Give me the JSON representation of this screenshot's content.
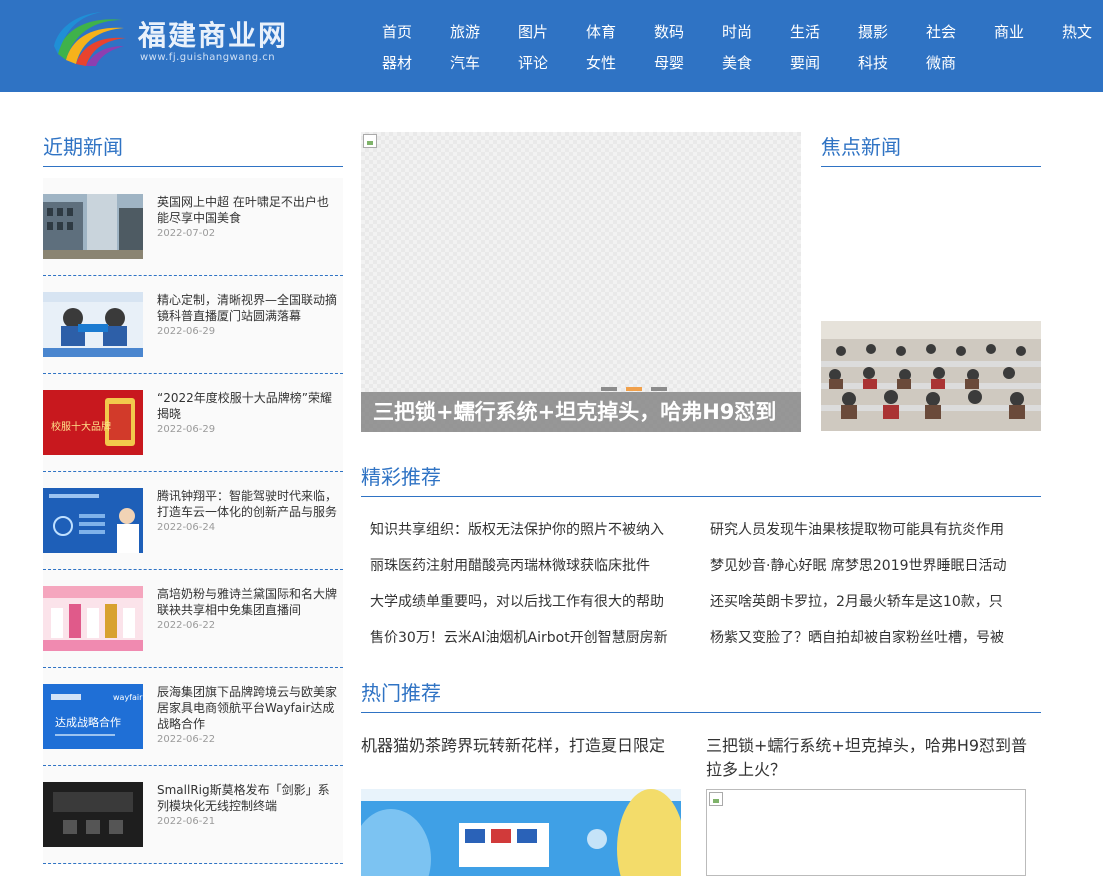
{
  "header": {
    "logo_title": "福建商业网",
    "logo_url": "www.fj.guishangwang.cn",
    "nav_row1": [
      "首页",
      "旅游",
      "图片",
      "体育",
      "数码",
      "时尚",
      "生活",
      "摄影",
      "社会",
      "商业",
      "热文"
    ],
    "nav_row2": [
      "器材",
      "汽车",
      "评论",
      "女性",
      "母婴",
      "美食",
      "要闻",
      "科技",
      "微商"
    ]
  },
  "recent": {
    "title": "近期新闻",
    "items": [
      {
        "title": "英国网上中超 在叶啸足不出户也能尽享中国美食",
        "date": "2022-07-02"
      },
      {
        "title": "精心定制，清晰视界—全国联动摘镜科普直播厦门站圆满落幕",
        "date": "2022-06-29"
      },
      {
        "title": "“2022年度校服十大品牌榜”荣耀揭晓",
        "date": "2022-06-29"
      },
      {
        "title": "腾讯钟翔平：智能驾驶时代来临，打造车云一体化的创新产品与服务",
        "date": "2022-06-24"
      },
      {
        "title": "高培奶粉与雅诗兰黛国际和名大牌联袂共享相中免集团直播间",
        "date": "2022-06-22"
      },
      {
        "title": "辰海集团旗下品牌跨境云与欧美家居家具电商领航平台Wayfair达成战略合作",
        "date": "2022-06-22"
      },
      {
        "title": "SmallRig斯莫格发布「剑影」系列模块化无线控制终端",
        "date": "2022-06-21"
      }
    ],
    "thumb_texts": {
      "t3": "校服十大品牌",
      "t6a": "达成战略合作",
      "t6b": "wayfair"
    }
  },
  "slider": {
    "caption": "三把锁+蠕行系统+坦克掉头，哈弗H9怼到",
    "dots": 3,
    "active_dot": 2
  },
  "focus": {
    "title": "焦点新闻"
  },
  "recommend": {
    "title": "精彩推荐",
    "items": [
      "知识共享组织：版权无法保护你的照片不被纳入",
      "研究人员发现牛油果核提取物可能具有抗炎作用",
      "丽珠医药注射用醋酸亮丙瑞林微球获临床批件",
      "梦见妙音·静心好眠 席梦思2019世界睡眠日活动",
      "大学成绩单重要吗，对以后找工作有很大的帮助",
      "还买啥英朗卡罗拉，2月最火轿车是这10款，只",
      "售价30万！云米AI油烟机Airbot开创智慧厨房新",
      "杨紫又变脸了？晒自拍却被自家粉丝吐槽，号被"
    ]
  },
  "hot": {
    "title": "热门推荐",
    "items": [
      {
        "title": "机器猫奶茶跨界玩转新花样，打造夏日限定"
      },
      {
        "title": "三把锁+蠕行系统+坦克掉头，哈弗H9怼到普拉多上火？"
      }
    ]
  },
  "colors": {
    "header_bg": "#2f73c4",
    "accent": "#2f73c4",
    "active_dot": "#f0a04b"
  }
}
